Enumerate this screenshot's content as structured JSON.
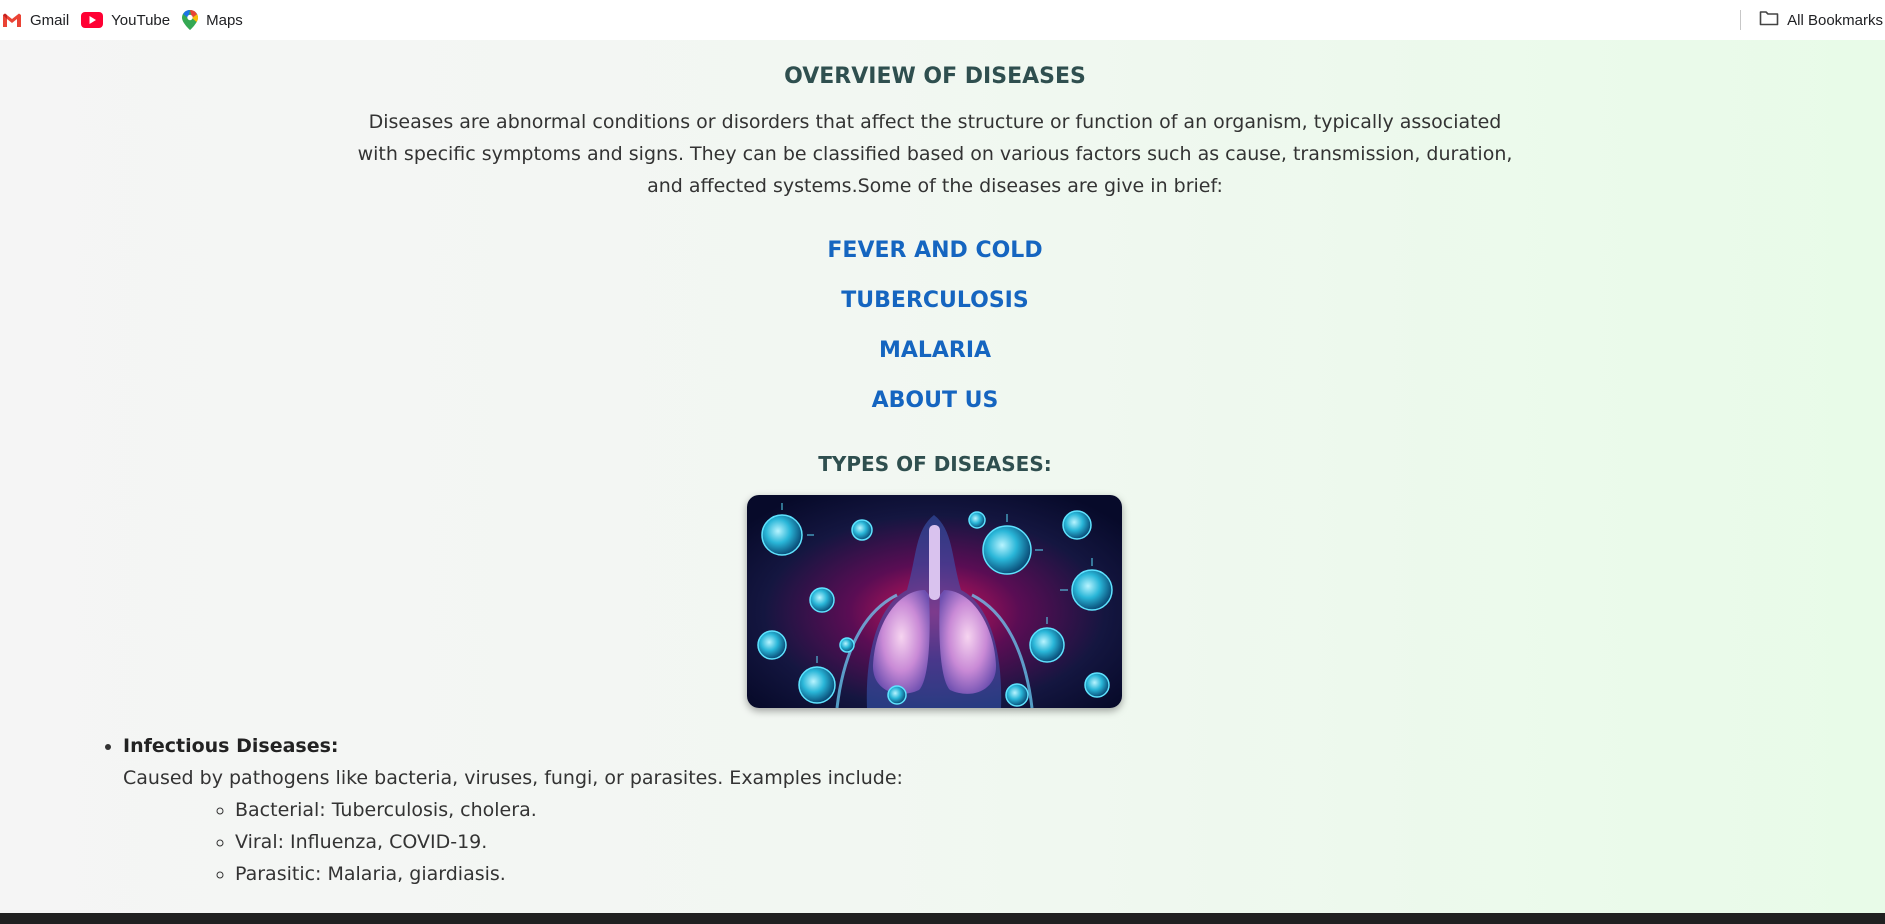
{
  "bookmarks": {
    "items": [
      {
        "label": "Gmail",
        "icon": "gmail-icon"
      },
      {
        "label": "YouTube",
        "icon": "youtube-icon"
      },
      {
        "label": "Maps",
        "icon": "maps-icon"
      }
    ],
    "all_bookmarks": "All Bookmarks"
  },
  "page": {
    "title": "OVERVIEW OF DISEASES",
    "intro": "Diseases are abnormal conditions or disorders that affect the structure or function of an organism, typically associated with specific symptoms and signs. They can be classified based on various factors such as cause, transmission, duration, and affected systems.Some of the diseases are give in brief:",
    "nav": [
      "FEVER AND COLD",
      "TUBERCULOSIS",
      "MALARIA",
      "ABOUT US"
    ],
    "types_heading": "TYPES OF DISEASES:",
    "image_subject": "virus-lungs-illustration",
    "infectious": {
      "heading": "Infectious Diseases:",
      "description": "Caused by pathogens like bacteria, viruses, fungi, or parasites. Examples include:",
      "examples": [
        "Bacterial: Tuberculosis, cholera.",
        "Viral: Influenza, COVID-19.",
        "Parasitic: Malaria, giardiasis."
      ]
    }
  },
  "colors": {
    "link": "#1565c0",
    "heading": "#2f4f4f",
    "text": "#333333",
    "bg_right": "#e8fbe8"
  }
}
